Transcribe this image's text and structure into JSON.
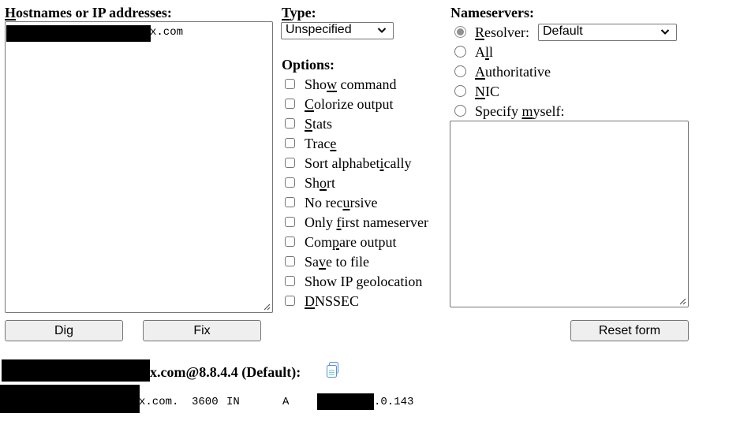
{
  "hosts": {
    "label_accesskey": "H",
    "label_rest": "ostnames or IP addresses:",
    "value_visible": "x.com"
  },
  "type": {
    "label_accesskey": "T",
    "label_rest": "ype:",
    "selected": "Unspecified"
  },
  "options": {
    "label": "Options:",
    "items": [
      {
        "pre": "Sho",
        "key": "w",
        "post": " command",
        "checked": false
      },
      {
        "pre": "",
        "key": "C",
        "post": "olorize output",
        "checked": false
      },
      {
        "pre": "",
        "key": "S",
        "post": "tats",
        "checked": false
      },
      {
        "pre": "Trac",
        "key": "e",
        "post": "",
        "checked": false
      },
      {
        "pre": "Sort alphabet",
        "key": "i",
        "post": "cally",
        "checked": false
      },
      {
        "pre": "Sh",
        "key": "o",
        "post": "rt",
        "checked": false
      },
      {
        "pre": "No rec",
        "key": "u",
        "post": "rsive",
        "checked": false
      },
      {
        "pre": "Only ",
        "key": "f",
        "post": "irst nameserver",
        "checked": false
      },
      {
        "pre": "Com",
        "key": "p",
        "post": "are output",
        "checked": false
      },
      {
        "pre": "Sa",
        "key": "v",
        "post": "e to file",
        "checked": false
      },
      {
        "pre": "Show IP geolocation",
        "key": "",
        "post": "",
        "checked": false
      },
      {
        "pre": "",
        "key": "D",
        "post": "NSSEC",
        "checked": false
      }
    ]
  },
  "nameservers": {
    "label": "Nameservers:",
    "resolver_selected": "Default",
    "radios": [
      {
        "pre": "",
        "key": "R",
        "post": "esolver:",
        "checked": true
      },
      {
        "pre": "A",
        "key": "l",
        "post": "l",
        "checked": false
      },
      {
        "pre": "",
        "key": "A",
        "post": "uthoritative",
        "checked": false
      },
      {
        "pre": "",
        "key": "N",
        "post": "IC",
        "checked": false
      },
      {
        "pre": "Specify ",
        "key": "m",
        "post": "yself:",
        "checked": false
      }
    ],
    "custom_value": ""
  },
  "buttons": {
    "dig": "Dig",
    "fix": "Fix",
    "reset": "Reset form"
  },
  "result": {
    "heading_visible": "x.com@8.8.4.4 (Default):",
    "copy_icon": "copy-icon",
    "record": {
      "name_visible": "x.com.",
      "ttl": "3600",
      "class": "IN",
      "type": "A",
      "value_visible": ".0.143"
    }
  }
}
